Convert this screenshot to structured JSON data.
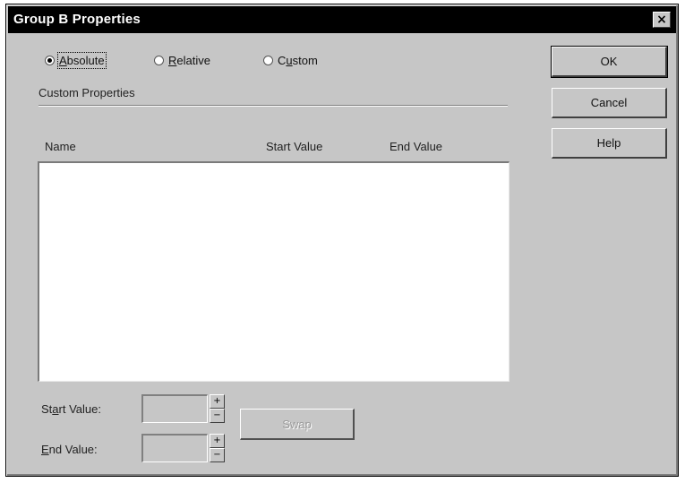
{
  "window": {
    "title": "Group B Properties",
    "close_glyph": "×"
  },
  "mode": {
    "options": [
      {
        "label_mnemonic": "A",
        "label_rest": "bsolute",
        "selected": true
      },
      {
        "label_mnemonic": "R",
        "label_rest": "elative",
        "selected": false
      },
      {
        "label_pre": "C",
        "label_mnemonic": "u",
        "label_rest": "stom",
        "selected": false
      }
    ]
  },
  "custom_properties": {
    "section_label": "Custom Properties",
    "columns": [
      "Name",
      "Start Value",
      "End Value"
    ],
    "rows": []
  },
  "start_value": {
    "label_pre": "St",
    "label_mnemonic": "a",
    "label_rest": "rt Value:",
    "value": ""
  },
  "end_value": {
    "label_mnemonic": "E",
    "label_rest": "nd Value:",
    "value": ""
  },
  "spin": {
    "up": "+",
    "down": "−"
  },
  "buttons": {
    "ok": "OK",
    "cancel": "Cancel",
    "help": "Help",
    "swap": "Swap"
  }
}
